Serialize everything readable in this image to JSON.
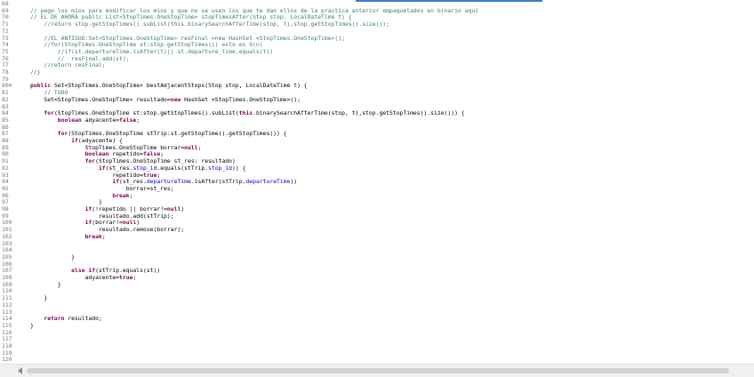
{
  "editor": {
    "lines": [
      {
        "n": "68",
        "tokens": []
      },
      {
        "n": "69",
        "tokens": [
          {
            "t": "// pego los mios para modificar los mios y que no se usen los que te dan ellos de la practica anterior empaquetados en binario aqui",
            "c": "comment"
          }
        ]
      },
      {
        "n": "70",
        "tokens": [
          {
            "t": "// EL DE AHORA public List<StopTimes.OneStopTime> stopTimesAfter(Stop stop, LocalDateTime t) {",
            "c": "comment"
          }
        ]
      },
      {
        "n": "71",
        "tokens": [
          {
            "t": "    //return stop.getStopTimes().subList(this.binarySearchAfterTime(stop, t),stop.getStopTimes().size());",
            "c": "comment"
          }
        ]
      },
      {
        "n": "72",
        "tokens": []
      },
      {
        "n": "73",
        "tokens": [
          {
            "t": "    //EL ANTIGUO:Set<StopTimes.OneStopTime> resFinal =new HashSet <StopTimes.OneStopTime>();",
            "c": "comment"
          }
        ]
      },
      {
        "n": "74",
        "tokens": [
          {
            "t": "    //for(StopTimes.OneStopTime st:stop.getStopTimes()) esto es O(n)",
            "c": "comment"
          }
        ]
      },
      {
        "n": "75",
        "tokens": [
          {
            "t": "        //if(st.departureTime.isAfter(t)|| st.departure_time.equals(t))",
            "c": "comment"
          }
        ]
      },
      {
        "n": "76",
        "tokens": [
          {
            "t": "        //  resFinal.add(st);",
            "c": "comment"
          }
        ]
      },
      {
        "n": "77",
        "tokens": [
          {
            "t": "    //return resFinal;",
            "c": "comment"
          }
        ]
      },
      {
        "n": "78",
        "tokens": [
          {
            "t": "//}",
            "c": "comment"
          }
        ]
      },
      {
        "n": "79",
        "tokens": []
      },
      {
        "n": "80⊖",
        "tokens": [
          {
            "t": "public ",
            "c": "kw"
          },
          {
            "t": "Set<StopTimes.OneStopTime> bestAdjacentStops(Stop stop, LocalDateTime t) {",
            "c": ""
          }
        ]
      },
      {
        "n": "81",
        "tokens": [
          {
            "t": "    // TODO",
            "c": "comment"
          }
        ]
      },
      {
        "n": "82",
        "tokens": [
          {
            "t": "    Set<StopTimes.OneStopTime> resultado=",
            "c": ""
          },
          {
            "t": "new ",
            "c": "kw"
          },
          {
            "t": "HashSet <StopTimes.OneStopTime>();",
            "c": ""
          }
        ]
      },
      {
        "n": "83",
        "tokens": []
      },
      {
        "n": "84",
        "tokens": [
          {
            "t": "    ",
            "c": ""
          },
          {
            "t": "for",
            "c": "kw"
          },
          {
            "t": "(StopTimes.OneStopTime st:stop.getStopTimes().subList(",
            "c": ""
          },
          {
            "t": "this",
            "c": "kw"
          },
          {
            "t": ".binarySearchAfterTime(stop, t),stop.getStopTimes().size())) {",
            "c": ""
          }
        ]
      },
      {
        "n": "85",
        "tokens": [
          {
            "t": "        ",
            "c": ""
          },
          {
            "t": "boolean ",
            "c": "kw"
          },
          {
            "t": "adyacente=",
            "c": ""
          },
          {
            "t": "false",
            "c": "kw"
          },
          {
            "t": ";",
            "c": ""
          }
        ]
      },
      {
        "n": "86",
        "tokens": []
      },
      {
        "n": "87",
        "tokens": [
          {
            "t": "        ",
            "c": ""
          },
          {
            "t": "for",
            "c": "kw"
          },
          {
            "t": "(StopTimes.OneStopTime stTrip:st.getStopTime().getStopTimes()) {",
            "c": ""
          }
        ]
      },
      {
        "n": "88",
        "tokens": [
          {
            "t": "            ",
            "c": ""
          },
          {
            "t": "if",
            "c": "kw"
          },
          {
            "t": "(adyacente) {",
            "c": ""
          }
        ]
      },
      {
        "n": "89",
        "tokens": [
          {
            "t": "                StopTimes.OneStopTime borrar=",
            "c": ""
          },
          {
            "t": "null",
            "c": "kw"
          },
          {
            "t": ";",
            "c": ""
          }
        ]
      },
      {
        "n": "90",
        "tokens": [
          {
            "t": "                ",
            "c": ""
          },
          {
            "t": "boolean ",
            "c": "kw"
          },
          {
            "t": "repetido=",
            "c": ""
          },
          {
            "t": "false",
            "c": "kw"
          },
          {
            "t": ";",
            "c": ""
          }
        ]
      },
      {
        "n": "91",
        "tokens": [
          {
            "t": "                ",
            "c": ""
          },
          {
            "t": "for",
            "c": "kw"
          },
          {
            "t": "(StopTimes.OneStopTime st_res: resultado)",
            "c": ""
          }
        ]
      },
      {
        "n": "92",
        "tokens": [
          {
            "t": "                    ",
            "c": ""
          },
          {
            "t": "if",
            "c": "kw"
          },
          {
            "t": "(st_res.",
            "c": ""
          },
          {
            "t": "stop_id",
            "c": "field"
          },
          {
            "t": ".equals(stTrip.",
            "c": ""
          },
          {
            "t": "stop_id",
            "c": "field"
          },
          {
            "t": ")) {",
            "c": ""
          }
        ]
      },
      {
        "n": "93",
        "tokens": [
          {
            "t": "                        repetido=",
            "c": ""
          },
          {
            "t": "true",
            "c": "kw"
          },
          {
            "t": ";",
            "c": ""
          }
        ]
      },
      {
        "n": "94",
        "tokens": [
          {
            "t": "                        ",
            "c": ""
          },
          {
            "t": "if",
            "c": "kw"
          },
          {
            "t": "(st_res.",
            "c": ""
          },
          {
            "t": "departureTime",
            "c": "field"
          },
          {
            "t": ".isAfter(stTrip.",
            "c": ""
          },
          {
            "t": "departureTime",
            "c": "field"
          },
          {
            "t": "))",
            "c": ""
          }
        ]
      },
      {
        "n": "95",
        "tokens": [
          {
            "t": "                            borrar=st_res;",
            "c": ""
          }
        ]
      },
      {
        "n": "96",
        "tokens": [
          {
            "t": "                        ",
            "c": ""
          },
          {
            "t": "break",
            "c": "kw"
          },
          {
            "t": ";",
            "c": ""
          }
        ]
      },
      {
        "n": "97",
        "tokens": [
          {
            "t": "                    }",
            "c": ""
          }
        ]
      },
      {
        "n": "98",
        "tokens": [
          {
            "t": "                ",
            "c": ""
          },
          {
            "t": "if",
            "c": "kw"
          },
          {
            "t": "(!repetido || borrar!=",
            "c": ""
          },
          {
            "t": "null",
            "c": "kw"
          },
          {
            "t": ")",
            "c": ""
          }
        ]
      },
      {
        "n": "99",
        "tokens": [
          {
            "t": "                    resultado.add(stTrip);",
            "c": ""
          }
        ]
      },
      {
        "n": "100",
        "tokens": [
          {
            "t": "                ",
            "c": ""
          },
          {
            "t": "if",
            "c": "kw"
          },
          {
            "t": "(borrar!=",
            "c": ""
          },
          {
            "t": "null",
            "c": "kw"
          },
          {
            "t": ")",
            "c": ""
          }
        ]
      },
      {
        "n": "101",
        "tokens": [
          {
            "t": "                    resultado.remove(borrar);",
            "c": ""
          }
        ]
      },
      {
        "n": "102",
        "tokens": [
          {
            "t": "                ",
            "c": ""
          },
          {
            "t": "break",
            "c": "kw"
          },
          {
            "t": ";",
            "c": ""
          }
        ]
      },
      {
        "n": "103",
        "tokens": []
      },
      {
        "n": "104",
        "tokens": []
      },
      {
        "n": "105",
        "tokens": [
          {
            "t": "            }",
            "c": ""
          }
        ]
      },
      {
        "n": "106",
        "tokens": []
      },
      {
        "n": "107",
        "tokens": [
          {
            "t": "            ",
            "c": ""
          },
          {
            "t": "else if",
            "c": "kw"
          },
          {
            "t": "(stTrip.equals(st))",
            "c": ""
          }
        ]
      },
      {
        "n": "108",
        "tokens": [
          {
            "t": "                adyacente=",
            "c": ""
          },
          {
            "t": "true",
            "c": "kw"
          },
          {
            "t": ";",
            "c": ""
          }
        ]
      },
      {
        "n": "109",
        "tokens": [
          {
            "t": "        }",
            "c": ""
          }
        ]
      },
      {
        "n": "110",
        "tokens": []
      },
      {
        "n": "111",
        "tokens": [
          {
            "t": "    }",
            "c": ""
          }
        ]
      },
      {
        "n": "112",
        "tokens": []
      },
      {
        "n": "113",
        "tokens": []
      },
      {
        "n": "114",
        "tokens": [
          {
            "t": "    ",
            "c": ""
          },
          {
            "t": "return ",
            "c": "kw"
          },
          {
            "t": "resultado;",
            "c": ""
          }
        ]
      },
      {
        "n": "115",
        "tokens": [
          {
            "t": "}",
            "c": ""
          }
        ]
      },
      {
        "n": "116",
        "tokens": []
      },
      {
        "n": "117",
        "tokens": []
      },
      {
        "n": "118",
        "tokens": []
      },
      {
        "n": "119",
        "tokens": []
      },
      {
        "n": "120",
        "tokens": []
      }
    ]
  },
  "colors": {
    "comment": "#3f7f5f",
    "keyword": "#7f0055",
    "field": "#0000c0",
    "line_number": "#787878"
  },
  "scrollbar": {
    "left_arrow_icon": "triangle-left-icon"
  }
}
